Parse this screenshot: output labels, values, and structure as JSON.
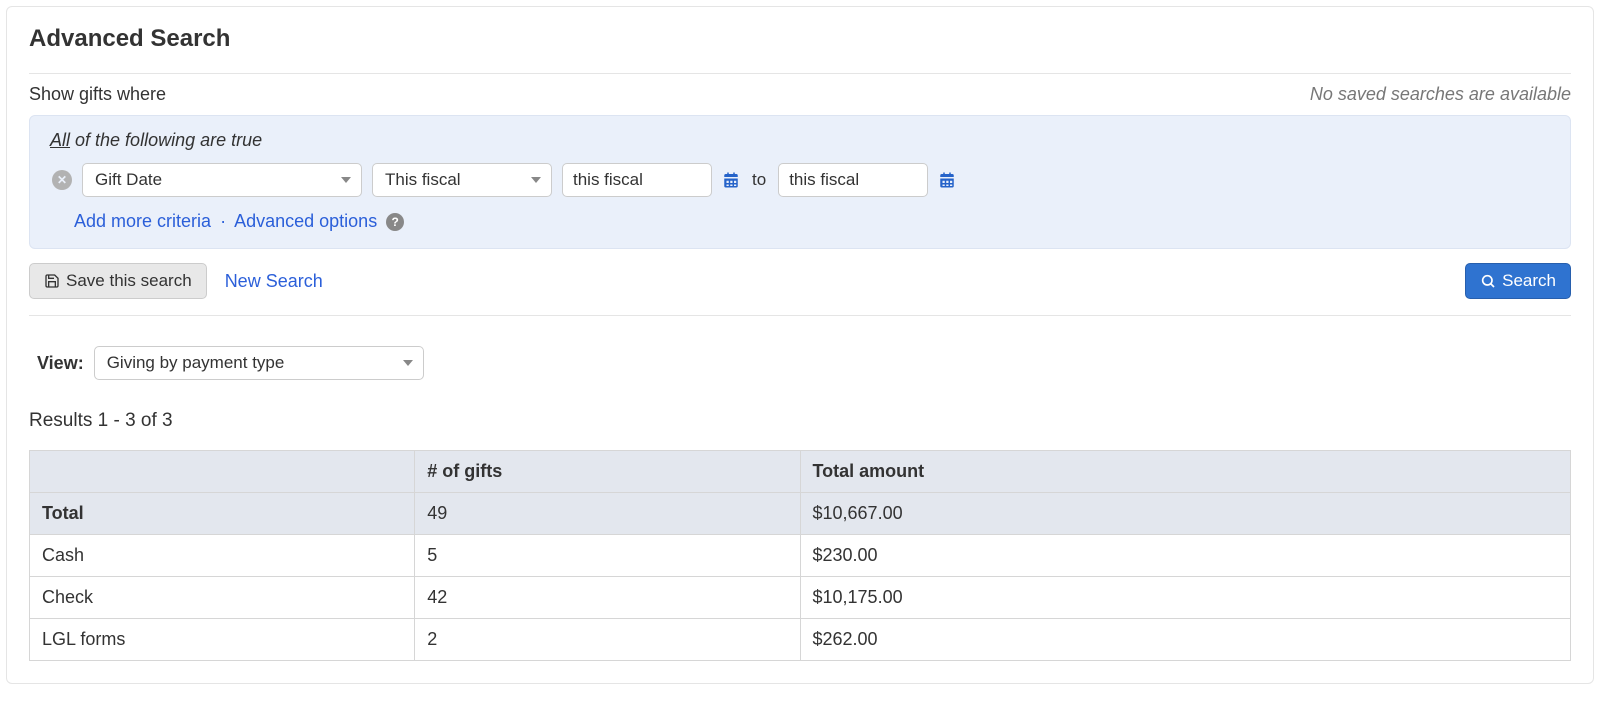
{
  "header": {
    "title": "Advanced Search",
    "subtitle": "Show gifts where",
    "no_saved": "No saved searches are available"
  },
  "criteria": {
    "rule_label_underline": "All",
    "rule_label_rest": " of the following are true",
    "field": "Gift Date",
    "range": "This fiscal",
    "date_from": "this fiscal",
    "date_to": "this fiscal",
    "to_label": "to",
    "add_more": "Add more criteria",
    "advanced": "Advanced options"
  },
  "actions": {
    "save_search": "Save this search",
    "new_search": "New Search",
    "search": "Search"
  },
  "view": {
    "label": "View:",
    "selected": "Giving by payment type"
  },
  "results": {
    "text": "Results 1 - 3 of 3",
    "headers": {
      "type": "",
      "count": "# of gifts",
      "amount": "Total amount"
    },
    "total": {
      "label": "Total",
      "count": "49",
      "amount": "$10,667.00"
    },
    "rows": [
      {
        "label": "Cash",
        "count": "5",
        "amount": "$230.00"
      },
      {
        "label": "Check",
        "count": "42",
        "amount": "$10,175.00"
      },
      {
        "label": "LGL forms",
        "count": "2",
        "amount": "$262.00"
      }
    ]
  }
}
